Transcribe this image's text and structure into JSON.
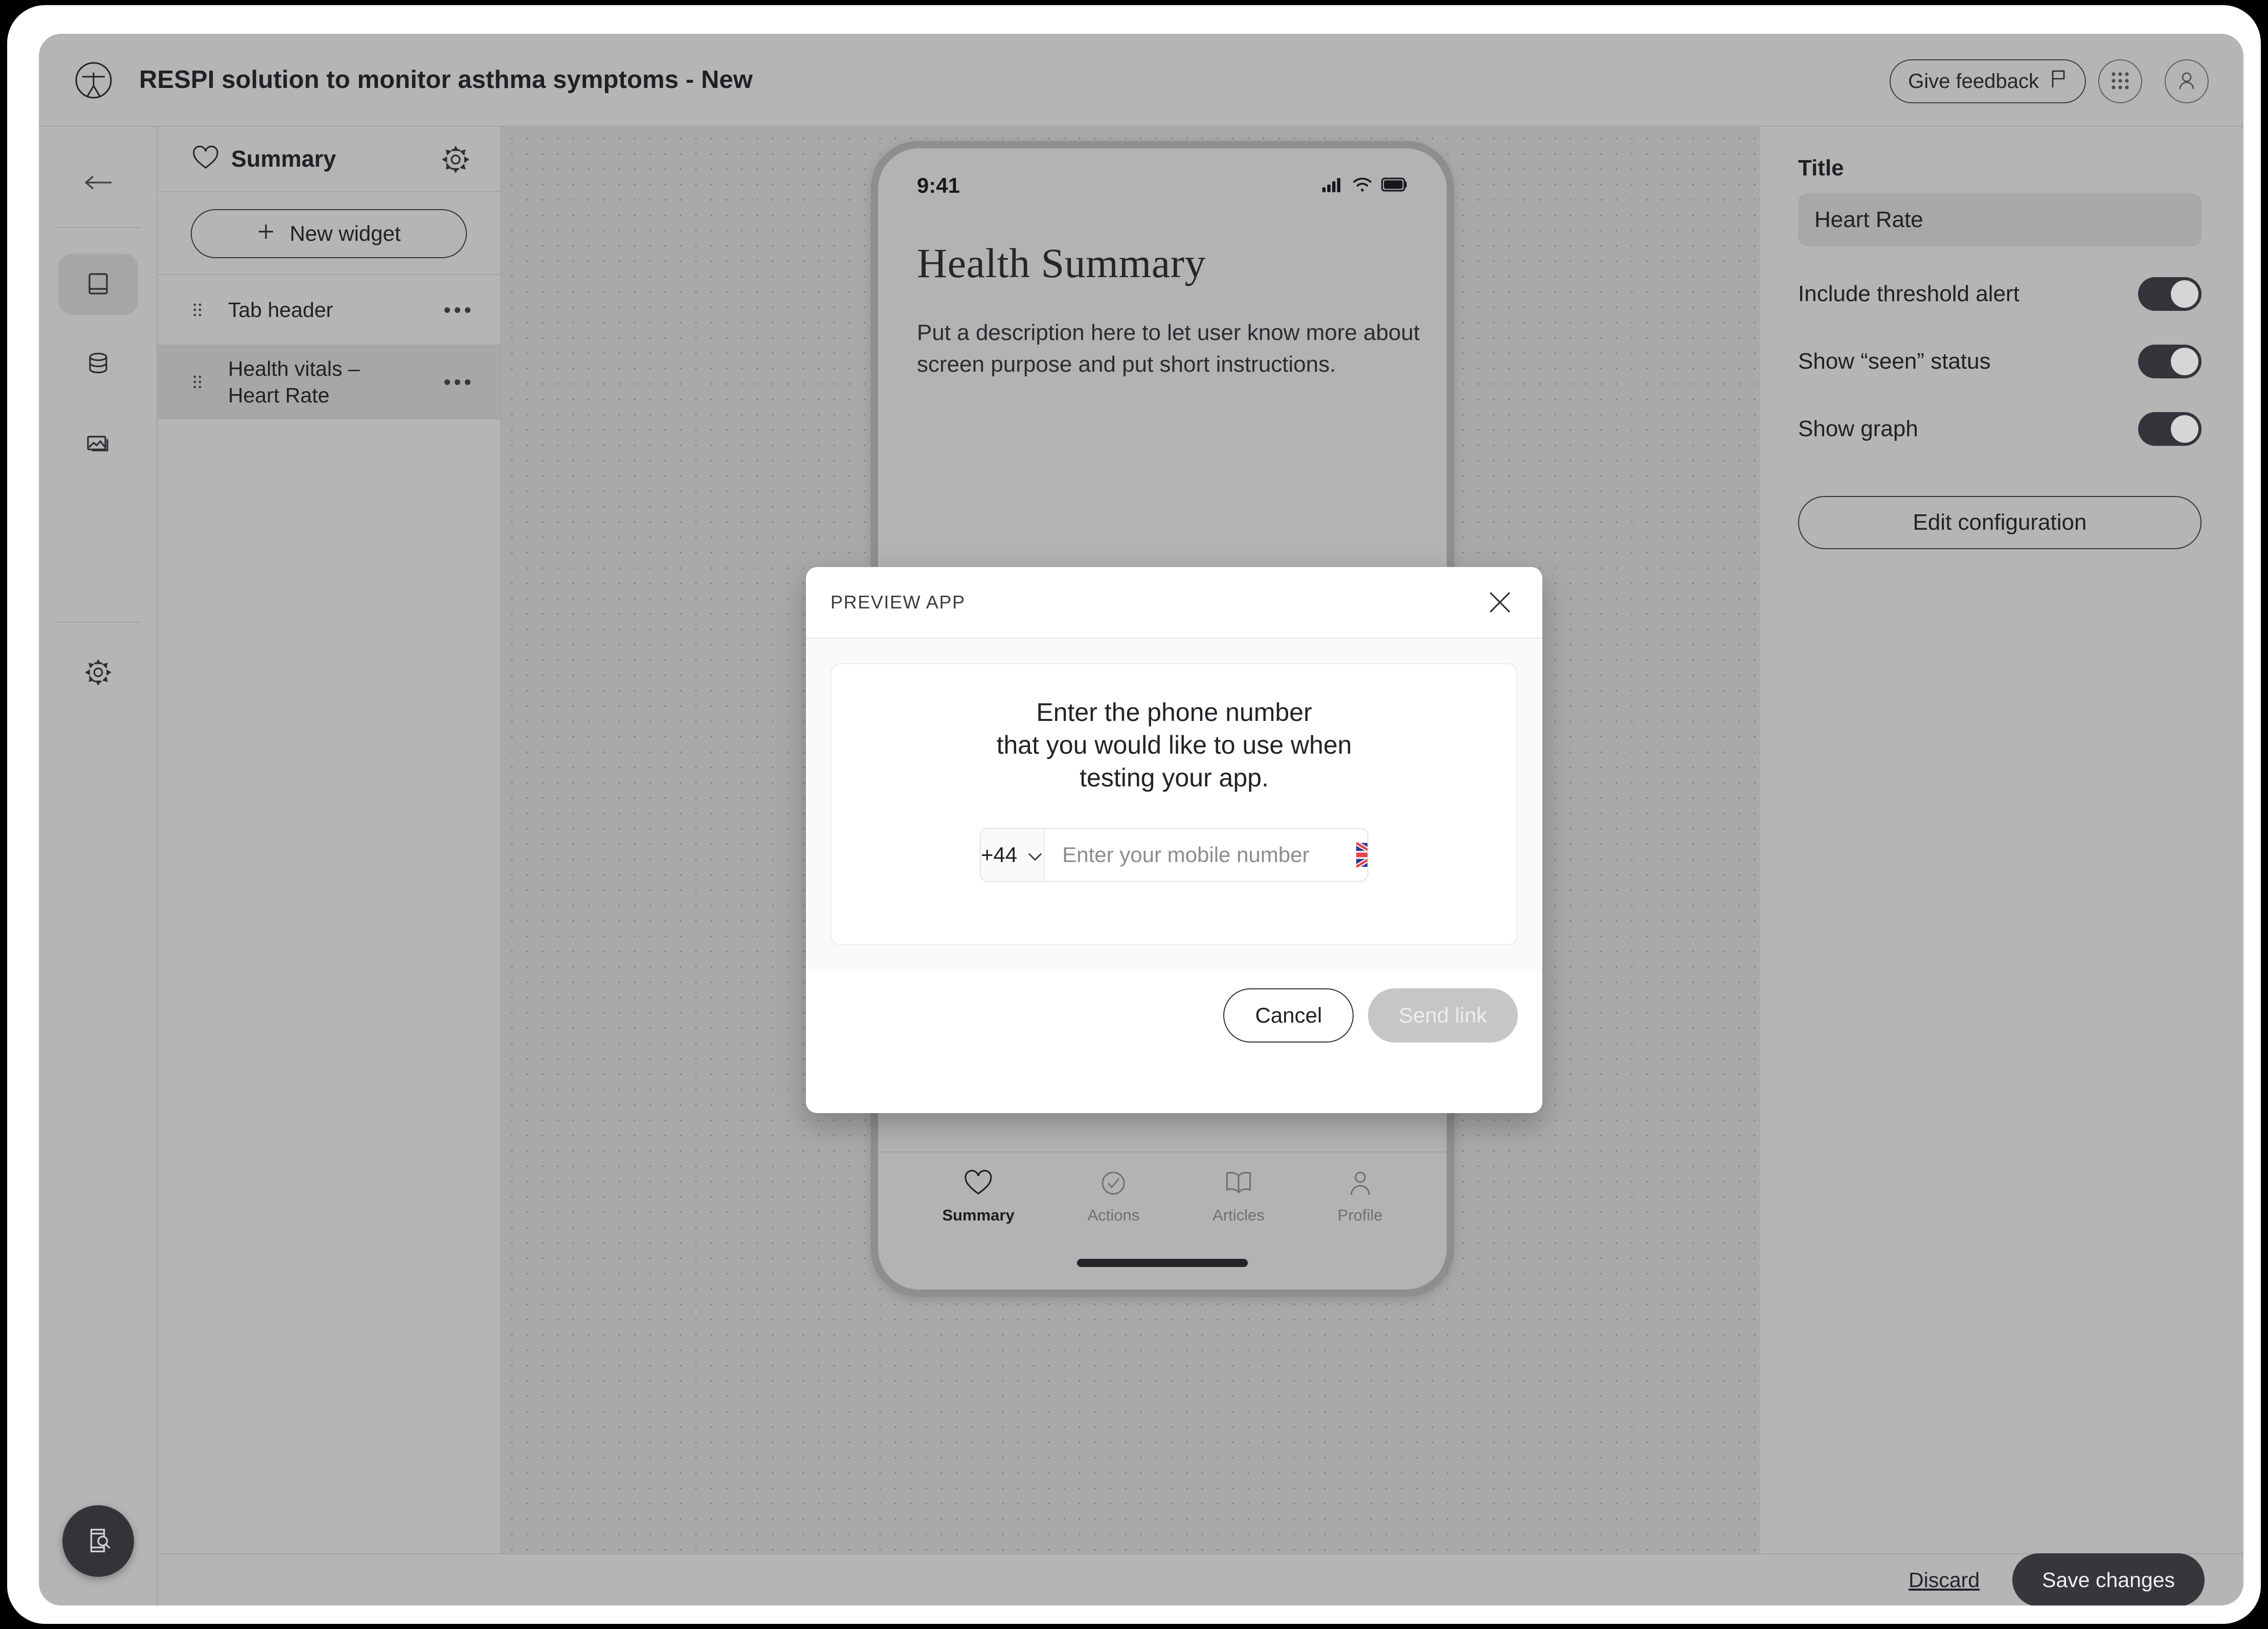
{
  "header": {
    "title": "RESPI solution to monitor asthma symptoms - New",
    "logo_icon": "respi-logo-icon",
    "give_feedback_label": "Give feedback",
    "give_feedback_icon": "flag-icon",
    "apps_grid_icon": "apps-grid-icon",
    "account_icon": "user-avatar-icon"
  },
  "left_rail": {
    "back_icon": "arrow-left-icon",
    "items": [
      {
        "name": "screens",
        "icon": "screen-icon",
        "active": true
      },
      {
        "name": "data",
        "icon": "database-icon",
        "active": false
      },
      {
        "name": "media",
        "icon": "image-stack-icon",
        "active": false
      },
      {
        "name": "settings",
        "icon": "gear-icon",
        "active": false
      }
    ],
    "preview_fab_icon": "mobile-preview-icon"
  },
  "widgets_panel": {
    "heart_icon": "heart-icon",
    "title": "Summary",
    "settings_icon": "gear-icon",
    "new_widget_label": "New widget",
    "new_widget_icon": "plus-icon",
    "rows": [
      {
        "label": "Tab header",
        "selected": false,
        "drag_icon": "drag-handle-icon",
        "more_icon": "more-horizontal-icon"
      },
      {
        "label": "Health vitals – Heart Rate",
        "selected": true,
        "drag_icon": "drag-handle-icon",
        "more_icon": "more-horizontal-icon"
      }
    ]
  },
  "phone_preview": {
    "status_time": "9:41",
    "status_icons": [
      "cellular-signal-icon",
      "wifi-icon",
      "battery-icon"
    ],
    "heading": "Health Summary",
    "description": "Put a description here to let user know more about screen purpose and put short instructions.",
    "tabs": [
      {
        "label": "Summary",
        "icon": "heart-icon",
        "active": true
      },
      {
        "label": "Actions",
        "icon": "check-circle-icon",
        "active": false
      },
      {
        "label": "Articles",
        "icon": "book-icon",
        "active": false
      },
      {
        "label": "Profile",
        "icon": "user-icon",
        "active": false
      }
    ]
  },
  "inspector": {
    "title_label": "Title",
    "title_value": "Heart Rate",
    "title_placeholder": "Heart Rate",
    "toggles": [
      {
        "label": "Include threshold alert",
        "on": true
      },
      {
        "label": "Show “seen” status",
        "on": true
      },
      {
        "label": "Show graph",
        "on": true
      }
    ],
    "edit_configuration_label": "Edit configuration"
  },
  "bottom_bar": {
    "discard_label": "Discard",
    "save_label": "Save changes"
  },
  "modal": {
    "eyebrow": "PREVIEW APP",
    "close_icon": "close-icon",
    "prompt": "Enter the phone number\nthat you would like to use when\ntesting your app.",
    "country_code": "+44",
    "country_code_caret_icon": "chevron-down-icon",
    "flag_icon": "uk-flag-icon",
    "number_placeholder": "Enter your mobile number",
    "number_value": "",
    "cancel_label": "Cancel",
    "send_link_label": "Send link"
  },
  "colors": {
    "app_background": "#b5b5b5",
    "canvas_background": "#a9a9a9",
    "canvas_dot": "#7e7e7e",
    "accent_dark": "#33353b",
    "selected_row": "#a7a7a7",
    "modal_surface": "#ffffff",
    "send_link_disabled": "#c6c6c6"
  }
}
